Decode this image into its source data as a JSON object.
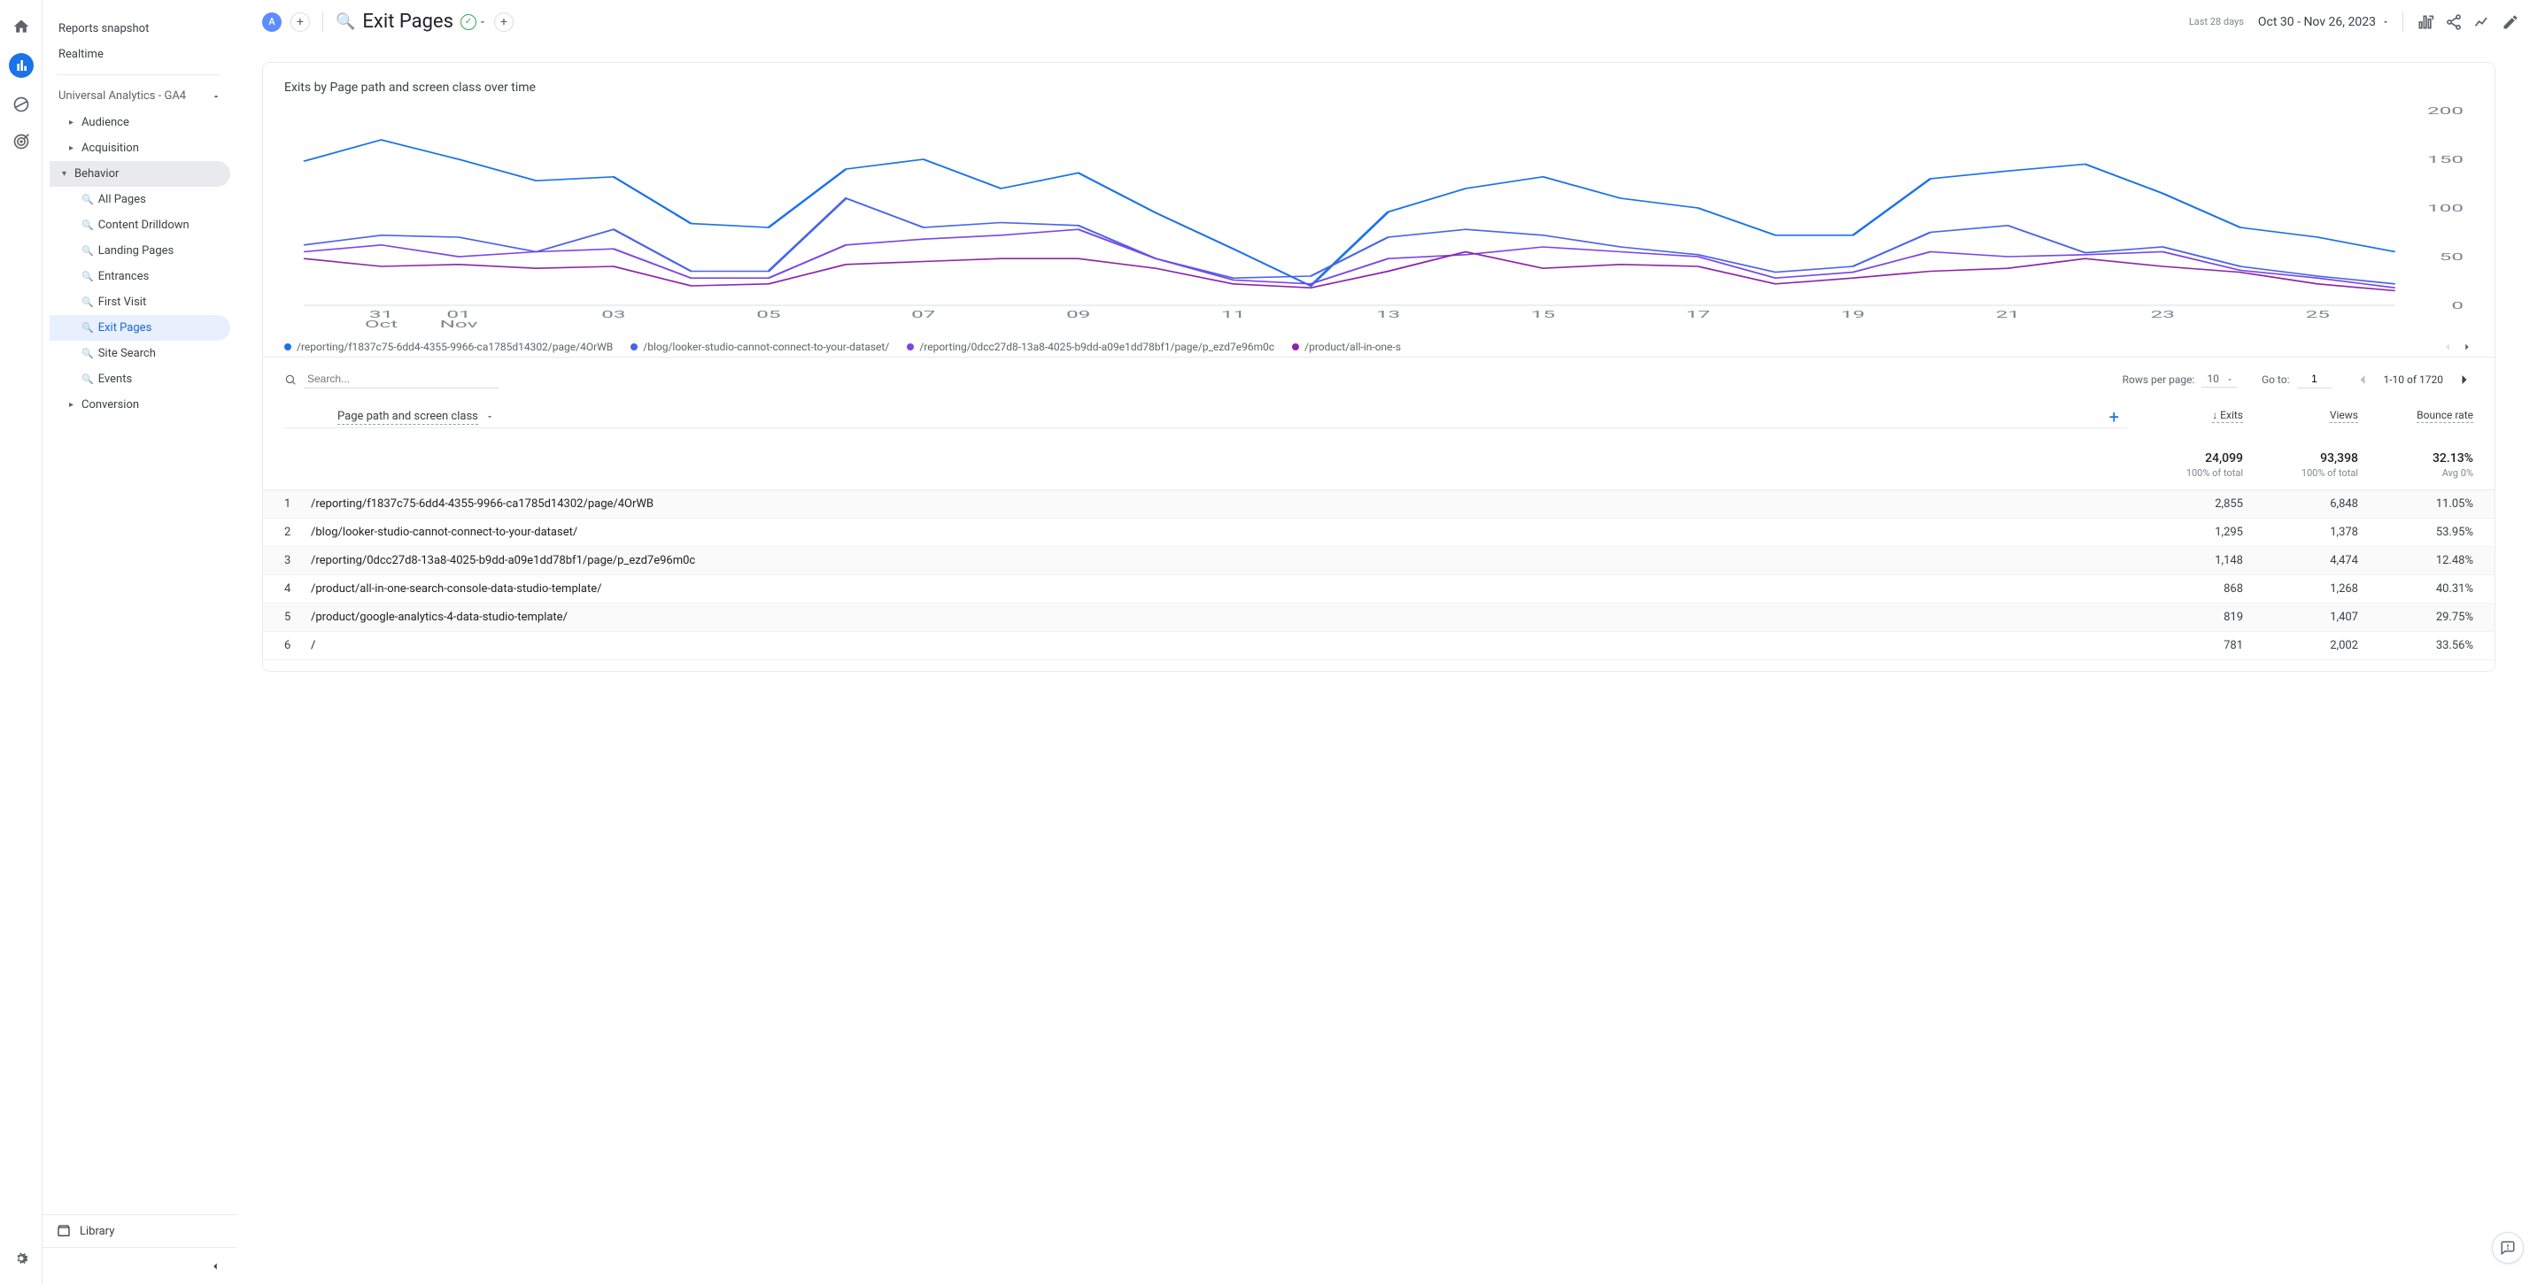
{
  "sidebar": {
    "top": [
      "Reports snapshot",
      "Realtime"
    ],
    "section": "Universal Analytics - GA4",
    "groups": [
      {
        "label": "Audience",
        "open": false
      },
      {
        "label": "Acquisition",
        "open": false
      },
      {
        "label": "Behavior",
        "open": true,
        "items": [
          "All Pages",
          "Content Drilldown",
          "Landing Pages",
          "Entrances",
          "First Visit",
          "Exit Pages",
          "Site Search",
          "Events"
        ],
        "active": "Exit Pages"
      },
      {
        "label": "Conversion",
        "open": false
      }
    ],
    "library": "Library"
  },
  "header": {
    "chip": "A",
    "title": "Exit Pages",
    "date_label": "Last 28 days",
    "date_range": "Oct 30 - Nov 26, 2023"
  },
  "card": {
    "title": "Exits by Page path and screen class over time",
    "legend": [
      {
        "color": "#1a73e8",
        "label": "/reporting/f1837c75-6dd4-4355-9966-ca1785d14302/page/4OrWB"
      },
      {
        "color": "#4964e9",
        "label": "/blog/looker-studio-cannot-connect-to-your-dataset/"
      },
      {
        "color": "#7a46e8",
        "label": "/reporting/0dcc27d8-13a8-4025-b9dd-a09e1dd78bf1/page/p_ezd7e96m0c"
      },
      {
        "color": "#8e24aa",
        "label": "/product/all-in-one-s"
      }
    ]
  },
  "table_controls": {
    "search_placeholder": "Search...",
    "rows_label": "Rows per page:",
    "rows_value": "10",
    "goto_label": "Go to:",
    "goto_value": "1",
    "range": "1-10 of 1720"
  },
  "table": {
    "dimension": "Page path and screen class",
    "metrics": [
      "Exits",
      "Views",
      "Bounce rate"
    ],
    "sort_metric": "Exits",
    "totals": {
      "Exits": {
        "val": "24,099",
        "sub": "100% of total"
      },
      "Views": {
        "val": "93,398",
        "sub": "100% of total"
      },
      "Bounce rate": {
        "val": "32.13%",
        "sub": "Avg 0%"
      }
    },
    "rows": [
      {
        "idx": "1",
        "path": "/reporting/f1837c75-6dd4-4355-9966-ca1785d14302/page/4OrWB",
        "Exits": "2,855",
        "Views": "6,848",
        "Bounce rate": "11.05%"
      },
      {
        "idx": "2",
        "path": "/blog/looker-studio-cannot-connect-to-your-dataset/",
        "Exits": "1,295",
        "Views": "1,378",
        "Bounce rate": "53.95%"
      },
      {
        "idx": "3",
        "path": "/reporting/0dcc27d8-13a8-4025-b9dd-a09e1dd78bf1/page/p_ezd7e96m0c",
        "Exits": "1,148",
        "Views": "4,474",
        "Bounce rate": "12.48%"
      },
      {
        "idx": "4",
        "path": "/product/all-in-one-search-console-data-studio-template/",
        "Exits": "868",
        "Views": "1,268",
        "Bounce rate": "40.31%"
      },
      {
        "idx": "5",
        "path": "/product/google-analytics-4-data-studio-template/",
        "Exits": "819",
        "Views": "1,407",
        "Bounce rate": "29.75%"
      },
      {
        "idx": "6",
        "path": "/",
        "Exits": "781",
        "Views": "2,002",
        "Bounce rate": "33.56%"
      }
    ]
  },
  "chart_data": {
    "type": "line",
    "xlabel": "",
    "ylabel": "",
    "ylim": [
      0,
      200
    ],
    "y_ticks": [
      0,
      50,
      100,
      150,
      200
    ],
    "x_ticks": [
      "31\nOct",
      "01\nNov",
      "03",
      "05",
      "07",
      "09",
      "11",
      "13",
      "15",
      "17",
      "19",
      "21",
      "23",
      "25"
    ],
    "x": [
      30,
      31,
      1,
      2,
      3,
      4,
      5,
      6,
      7,
      8,
      9,
      10,
      11,
      12,
      13,
      14,
      15,
      16,
      17,
      18,
      19,
      20,
      21,
      22,
      23,
      24,
      25,
      26
    ],
    "series": [
      {
        "name": "/reporting/f1837c75-6dd4-4355-9966-ca1785d14302/page/4OrWB",
        "color": "#1a73e8",
        "values": [
          148,
          170,
          150,
          128,
          132,
          84,
          80,
          140,
          150,
          120,
          136,
          95,
          58,
          20,
          96,
          120,
          132,
          110,
          100,
          72,
          72,
          130,
          138,
          145,
          115,
          80,
          70,
          55
        ]
      },
      {
        "name": "/blog/looker-studio-cannot-connect-to-your-dataset/",
        "color": "#4964e9",
        "values": [
          62,
          72,
          70,
          55,
          78,
          35,
          35,
          110,
          80,
          85,
          82,
          48,
          28,
          30,
          70,
          78,
          72,
          60,
          52,
          34,
          40,
          75,
          82,
          54,
          60,
          40,
          30,
          22
        ]
      },
      {
        "name": "/reporting/0dcc27d8-13a8-4025-b9dd-a09e1dd78bf1/page/p_ezd7e96m0c",
        "color": "#7a46e8",
        "values": [
          55,
          62,
          50,
          55,
          58,
          28,
          28,
          62,
          68,
          72,
          78,
          48,
          26,
          22,
          48,
          52,
          60,
          55,
          50,
          28,
          34,
          55,
          50,
          52,
          55,
          36,
          28,
          18
        ]
      },
      {
        "name": "/product/all-in-one-search-console-data-studio-template/",
        "color": "#8e24aa",
        "values": [
          48,
          40,
          42,
          38,
          40,
          20,
          22,
          42,
          45,
          48,
          48,
          38,
          22,
          18,
          35,
          55,
          38,
          42,
          40,
          22,
          28,
          35,
          38,
          48,
          40,
          34,
          22,
          15
        ]
      }
    ]
  }
}
